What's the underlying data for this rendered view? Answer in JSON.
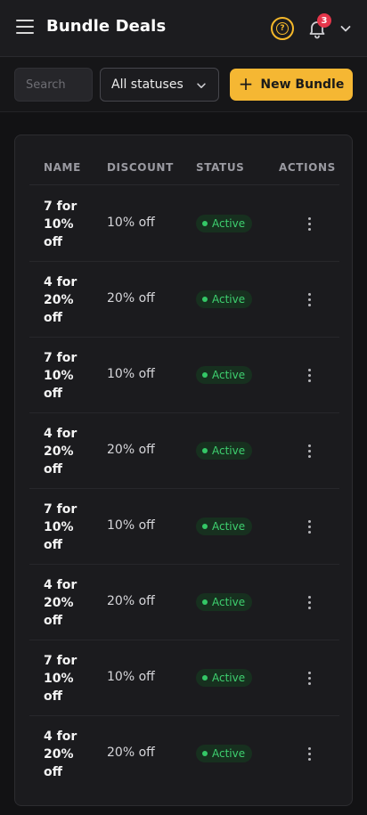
{
  "header": {
    "title": "Bundle Deals",
    "menu_icon": "hamburger-menu-icon",
    "help_icon": "question-circle-icon",
    "bell_icon": "bell-icon",
    "notification_count": "3",
    "account_icon": "chevron-down-icon"
  },
  "toolbar": {
    "search_placeholder": "Search",
    "status_filter": "All statuses",
    "new_bundle_label": "New Bundle",
    "new_bundle_icon": "plus-icon"
  },
  "colors": {
    "accent": "#f5b733",
    "background": "#121214",
    "card": "#1b1b1e",
    "active": "#3ed06f",
    "badge": "#e5364b"
  },
  "table": {
    "columns": [
      "NAME",
      "DISCOUNT",
      "STATUS",
      "ACTIONS"
    ],
    "rows": [
      {
        "name": "7 for 10% off",
        "discount": "10% off",
        "status": "Active"
      },
      {
        "name": "4 for 20% off",
        "discount": "20% off",
        "status": "Active"
      },
      {
        "name": "7 for 10% off",
        "discount": "10% off",
        "status": "Active"
      },
      {
        "name": "4 for 20% off",
        "discount": "20% off",
        "status": "Active"
      },
      {
        "name": "7 for 10% off",
        "discount": "10% off",
        "status": "Active"
      },
      {
        "name": "4 for 20% off",
        "discount": "20% off",
        "status": "Active"
      },
      {
        "name": "7 for 10% off",
        "discount": "10% off",
        "status": "Active"
      },
      {
        "name": "4 for 20% off",
        "discount": "20% off",
        "status": "Active"
      }
    ]
  }
}
